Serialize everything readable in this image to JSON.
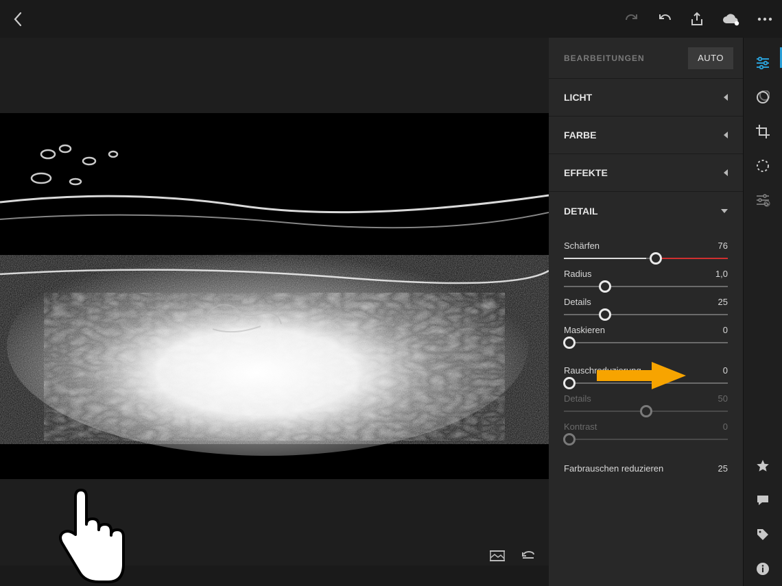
{
  "panel": {
    "title": "BEARBEITUNGEN",
    "autoLabel": "AUTO",
    "sections": {
      "licht": "LICHT",
      "farbe": "FARBE",
      "effekte": "EFFEKTE",
      "detail": "DETAIL"
    },
    "detail": {
      "schaerfen": {
        "label": "Schärfen",
        "value": "76",
        "pct": 56,
        "half": 50
      },
      "radius": {
        "label": "Radius",
        "value": "1,0",
        "pct": 25
      },
      "details": {
        "label": "Details",
        "value": "25",
        "pct": 25
      },
      "maskieren": {
        "label": "Maskieren",
        "value": "0",
        "pct": 3.5
      },
      "rausch": {
        "label": "Rauschreduzierung",
        "value": "0",
        "pct": 3.5
      },
      "d2": {
        "label": "Details",
        "value": "50",
        "pct": 50
      },
      "kontrast": {
        "label": "Kontrast",
        "value": "0",
        "pct": 3.5
      },
      "farbr": {
        "label": "Farbrauschen reduzieren",
        "value": "25"
      }
    }
  },
  "colors": {
    "accent": "#2a9fd6",
    "arrow": "#f7a400"
  }
}
